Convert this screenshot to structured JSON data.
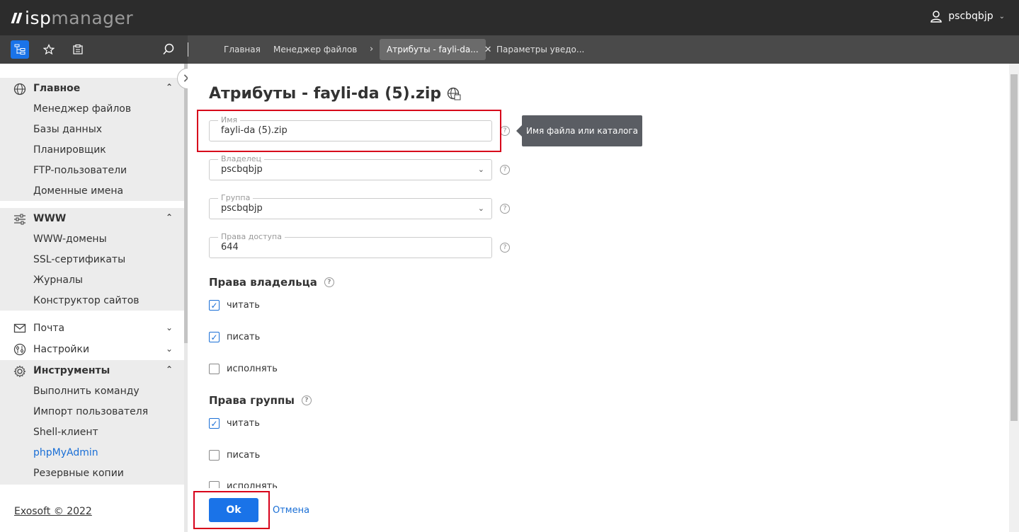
{
  "header": {
    "logo_isp": "isp",
    "logo_manager": "manager",
    "username": "pscbqbjp"
  },
  "tabs": [
    {
      "label": "Главная"
    },
    {
      "label": "Менеджер файлов"
    },
    {
      "label": "Атрибуты - fayli-da..."
    },
    {
      "label": "Параметры уведо..."
    }
  ],
  "sidebar": {
    "groups": {
      "main": {
        "label": "Главное",
        "items": [
          "Менеджер файлов",
          "Базы данных",
          "Планировщик",
          "FTP-пользователи",
          "Доменные имена"
        ]
      },
      "www": {
        "label": "WWW",
        "items": [
          "WWW-домены",
          "SSL-сертификаты",
          "Журналы",
          "Конструктор сайтов"
        ]
      },
      "mail": {
        "label": "Почта"
      },
      "settings": {
        "label": "Настройки"
      },
      "tools": {
        "label": "Инструменты",
        "items": [
          "Выполнить команду",
          "Импорт пользователя",
          "Shell-клиент",
          "phpMyAdmin",
          "Резервные копии"
        ]
      }
    },
    "footer": "Exosoft © 2022"
  },
  "form": {
    "title": "Атрибуты - fayli-da (5).zip",
    "name": {
      "label": "Имя",
      "value": "fayli-da (5).zip"
    },
    "owner": {
      "label": "Владелец",
      "value": "pscbqbjp"
    },
    "group": {
      "label": "Группа",
      "value": "pscbqbjp"
    },
    "perms": {
      "label": "Права доступа",
      "value": "644"
    },
    "tooltip": "Имя файла или каталога",
    "owner_rights": {
      "label": "Права владельца",
      "read": "читать",
      "write": "писать",
      "exec": "исполнять"
    },
    "group_rights": {
      "label": "Права группы",
      "read": "читать",
      "write": "писать",
      "exec": "исполнять"
    },
    "ok": "Ok",
    "cancel": "Отмена"
  },
  "colors": {
    "accent": "#1a73e8",
    "highlight": "#d7001a"
  }
}
